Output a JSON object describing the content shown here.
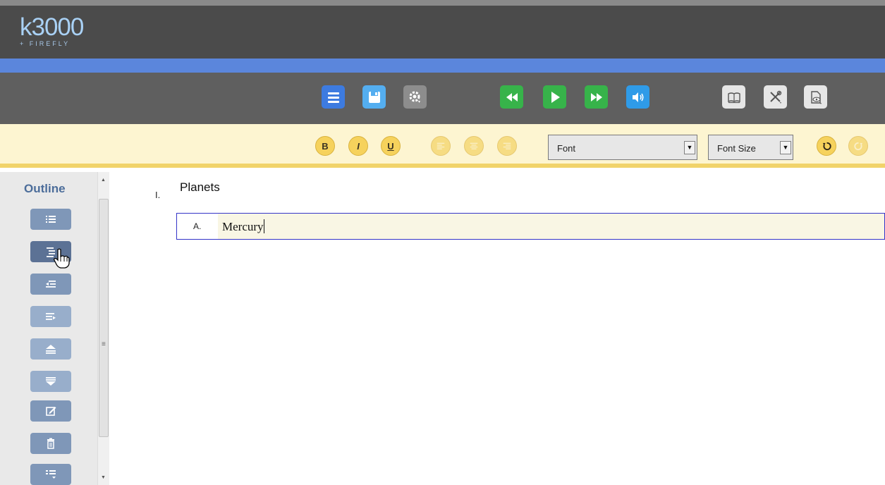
{
  "header": {
    "logo_main": "k3000",
    "logo_sub": "+ FIREFLY"
  },
  "toolbar": {
    "groups": [
      [
        "menu-icon",
        "save-icon",
        "settings-speech-icon"
      ],
      [
        "rewind-icon",
        "play-icon",
        "fast-forward-icon",
        "speaker-icon"
      ],
      [
        "book-icon",
        "tools-icon",
        "document-view-icon"
      ]
    ],
    "colors": {
      "menu": "#3d7be0",
      "save": "#54aef0",
      "settings": "#8d8d8d",
      "playback": "#37b34a",
      "speaker": "#2f9be8",
      "tools": "#e6e6e6"
    }
  },
  "format": {
    "bold_label": "B",
    "italic_label": "I",
    "underline_label": "U",
    "font_value": "Font",
    "font_size_value": "Font Size"
  },
  "sidebar": {
    "title": "Outline",
    "buttons": [
      "outline-list-icon",
      "indent-icon",
      "outdent-icon",
      "promote-icon",
      "move-up-icon",
      "move-down-icon",
      "edit-icon",
      "delete-icon",
      "outline-options-icon"
    ]
  },
  "document": {
    "items": [
      {
        "marker": "I.",
        "text": "Planets"
      },
      {
        "marker": "A.",
        "text": "Mercury"
      }
    ]
  }
}
